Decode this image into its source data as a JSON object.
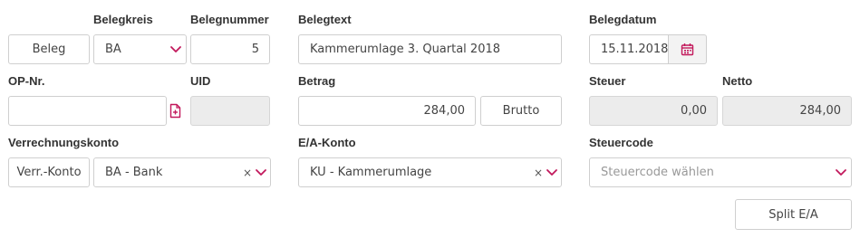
{
  "labels": {
    "belegkreis": "Belegkreis",
    "belegnummer": "Belegnummer",
    "belegtext": "Belegtext",
    "belegdatum": "Belegdatum",
    "op_nr": "OP-Nr.",
    "uid": "UID",
    "betrag": "Betrag",
    "steuer": "Steuer",
    "netto": "Netto",
    "verrechnungskonto": "Verrechnungskonto",
    "ea_konto": "E/A-Konto",
    "steuercode": "Steuercode"
  },
  "buttons": {
    "beleg": "Beleg",
    "brutto": "Brutto",
    "verr_konto": "Verr.-Konto",
    "split": "Split E/A"
  },
  "fields": {
    "belegkreis_value": "BA",
    "belegnummer_value": "5",
    "belegtext_value": "Kammerumlage 3. Quartal 2018",
    "belegdatum_value": "15.11.2018",
    "op_nr_value": "",
    "uid_value": "",
    "betrag_value": "284,00",
    "steuer_value": "0,00",
    "netto_value": "284,00",
    "verrechnungskonto_value": "BA - Bank",
    "ea_konto_value": "KU - Kammerumlage",
    "steuercode_placeholder": "Steuercode wählen"
  },
  "icons": {
    "clear_glyph": "×"
  },
  "colors": {
    "accent": "#c2185b",
    "border": "#cfcfcf",
    "disabled_bg": "#ececec"
  }
}
